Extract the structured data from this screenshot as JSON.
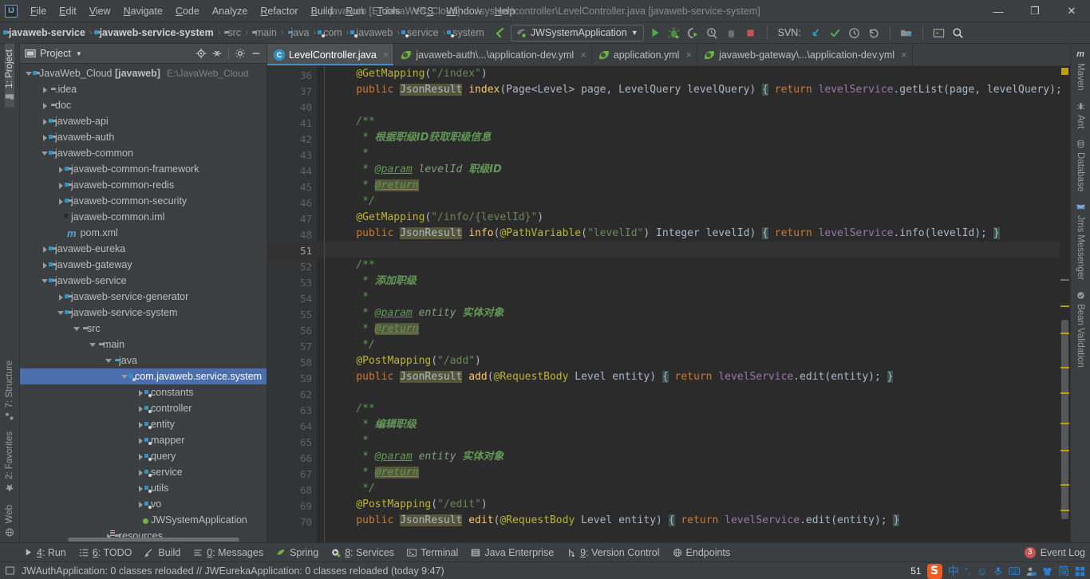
{
  "window": {
    "title": "javaweb [E:\\JavaWeb_Cloud] - ...\\system\\controller\\LevelController.java [javaweb-service-system]",
    "minimize": "—",
    "maximize": "❐",
    "close": "✕"
  },
  "menu": {
    "items": [
      "File",
      "Edit",
      "View",
      "Navigate",
      "Code",
      "Analyze",
      "Refactor",
      "Build",
      "Run",
      "Tools",
      "VCS",
      "Window",
      "Help"
    ]
  },
  "navbar": {
    "breadcrumbs": [
      {
        "label": "javaweb-service",
        "icon": "module-icon",
        "bold": true
      },
      {
        "label": "javaweb-service-system",
        "icon": "module-icon",
        "bold": true
      },
      {
        "label": "src",
        "icon": "folder-icon",
        "bold": false
      },
      {
        "label": "main",
        "icon": "folder-icon",
        "bold": false
      },
      {
        "label": "java",
        "icon": "source-folder-icon",
        "bold": false
      },
      {
        "label": "com",
        "icon": "package-icon",
        "bold": false
      },
      {
        "label": "javaweb",
        "icon": "package-icon",
        "bold": false
      },
      {
        "label": "service",
        "icon": "package-icon",
        "bold": false
      },
      {
        "label": "system",
        "icon": "package-icon",
        "bold": false
      }
    ],
    "run_config": "JWSystemApplication",
    "svn_label": "SVN:",
    "toolbar_icons": [
      "back-arrow-icon",
      "run-icon",
      "debug-icon",
      "run-coverage-icon",
      "profiler-icon",
      "attach-icon",
      "stop-icon",
      "svn-update-icon",
      "svn-commit-icon",
      "svn-history-icon",
      "svn-rollback-icon",
      "project-structure-icon",
      "terminal-icon",
      "search-everywhere-icon"
    ]
  },
  "left_strip": {
    "top": [
      {
        "label": "1: Project",
        "icon": "project-icon",
        "active": true
      }
    ],
    "bottom": [
      {
        "label": "7: Structure",
        "icon": "structure-icon"
      },
      {
        "label": "2: Favorites",
        "icon": "star-icon"
      },
      {
        "label": "Web",
        "icon": "web-icon"
      }
    ]
  },
  "right_strip": {
    "items": [
      {
        "label": "Maven",
        "icon": "maven-icon"
      },
      {
        "label": "Ant",
        "icon": "ant-icon"
      },
      {
        "label": "Database",
        "icon": "database-icon"
      },
      {
        "label": "Jms Messenger",
        "icon": "jms-icon"
      },
      {
        "label": "Bean Validation",
        "icon": "bean-validation-icon"
      }
    ]
  },
  "project_panel": {
    "title": "Project",
    "header_icons": [
      "locate-icon",
      "collapse-all-icon",
      "settings-icon",
      "hide-icon"
    ],
    "tree": [
      {
        "depth": 0,
        "arrow": "down",
        "icon": "module-icon",
        "label": "JavaWeb_Cloud",
        "suffix": "[javaweb]",
        "path": "E:\\JavaWeb_Cloud",
        "selected": false
      },
      {
        "depth": 1,
        "arrow": "right",
        "icon": "folder-icon",
        "label": ".idea",
        "selected": false
      },
      {
        "depth": 1,
        "arrow": "right",
        "icon": "folder-icon",
        "label": "doc",
        "selected": false
      },
      {
        "depth": 1,
        "arrow": "right",
        "icon": "module-icon",
        "label": "javaweb-api",
        "selected": false
      },
      {
        "depth": 1,
        "arrow": "right",
        "icon": "module-icon",
        "label": "javaweb-auth",
        "selected": false
      },
      {
        "depth": 1,
        "arrow": "down",
        "icon": "module-icon",
        "label": "javaweb-common",
        "selected": false
      },
      {
        "depth": 2,
        "arrow": "right",
        "icon": "module-icon",
        "label": "javaweb-common-framework",
        "selected": false
      },
      {
        "depth": 2,
        "arrow": "right",
        "icon": "module-icon",
        "label": "javaweb-common-redis",
        "selected": false
      },
      {
        "depth": 2,
        "arrow": "right",
        "icon": "module-icon",
        "label": "javaweb-common-security",
        "selected": false
      },
      {
        "depth": 2,
        "arrow": "none",
        "icon": "iml-file-icon",
        "label": "javaweb-common.iml",
        "selected": false
      },
      {
        "depth": 2,
        "arrow": "none",
        "icon": "maven-pom-icon",
        "label": "pom.xml",
        "selected": false
      },
      {
        "depth": 1,
        "arrow": "right",
        "icon": "module-icon",
        "label": "javaweb-eureka",
        "selected": false
      },
      {
        "depth": 1,
        "arrow": "right",
        "icon": "module-icon",
        "label": "javaweb-gateway",
        "selected": false
      },
      {
        "depth": 1,
        "arrow": "down",
        "icon": "module-icon",
        "label": "javaweb-service",
        "selected": false
      },
      {
        "depth": 2,
        "arrow": "right",
        "icon": "module-icon",
        "label": "javaweb-service-generator",
        "selected": false
      },
      {
        "depth": 2,
        "arrow": "down",
        "icon": "module-icon",
        "label": "javaweb-service-system",
        "selected": false
      },
      {
        "depth": 3,
        "arrow": "down",
        "icon": "folder-icon",
        "label": "src",
        "selected": false
      },
      {
        "depth": 4,
        "arrow": "down",
        "icon": "folder-icon",
        "label": "main",
        "selected": false
      },
      {
        "depth": 5,
        "arrow": "down",
        "icon": "source-folder-icon",
        "label": "java",
        "selected": false
      },
      {
        "depth": 6,
        "arrow": "down",
        "icon": "package-icon",
        "label": "com.javaweb.service.system",
        "selected": true
      },
      {
        "depth": 7,
        "arrow": "right",
        "icon": "package-icon",
        "label": "constants",
        "selected": false
      },
      {
        "depth": 7,
        "arrow": "right",
        "icon": "package-icon",
        "label": "controller",
        "selected": false
      },
      {
        "depth": 7,
        "arrow": "right",
        "icon": "package-icon",
        "label": "entity",
        "selected": false
      },
      {
        "depth": 7,
        "arrow": "right",
        "icon": "package-icon",
        "label": "mapper",
        "selected": false
      },
      {
        "depth": 7,
        "arrow": "right",
        "icon": "package-icon",
        "label": "query",
        "selected": false
      },
      {
        "depth": 7,
        "arrow": "right",
        "icon": "package-icon",
        "label": "service",
        "selected": false
      },
      {
        "depth": 7,
        "arrow": "right",
        "icon": "package-icon",
        "label": "utils",
        "selected": false
      },
      {
        "depth": 7,
        "arrow": "right",
        "icon": "package-icon",
        "label": "vo",
        "selected": false
      },
      {
        "depth": 7,
        "arrow": "none",
        "icon": "spring-boot-class-icon",
        "label": "JWSystemApplication",
        "selected": false
      },
      {
        "depth": 5,
        "arrow": "right",
        "icon": "resources-folder-icon",
        "label": "resources",
        "selected": false
      }
    ]
  },
  "editor": {
    "tabs": [
      {
        "label": "LevelController.java",
        "icon": "java-class-icon",
        "active": true
      },
      {
        "label": "javaweb-auth\\...\\application-dev.yml",
        "icon": "spring-yaml-icon",
        "active": false
      },
      {
        "label": "application.yml",
        "icon": "spring-yaml-icon",
        "active": false
      },
      {
        "label": "javaweb-gateway\\...\\application-dev.yml",
        "icon": "spring-yaml-icon",
        "active": false
      }
    ],
    "current_line": 51,
    "lines": [
      {
        "n": 36,
        "fold": "none",
        "html": "    <span class=\"ann\">@GetMapping</span>(<span class=\"str\">\"/index\"</span>)"
      },
      {
        "n": 37,
        "fold": "plus",
        "html": "    <span class=\"kw\">public</span> <span class=\"typehl\">JsonResult</span> <span class=\"meth\">index</span>(Page&lt;Level&gt; page, LevelQuery levelQuery) <span class=\"brace-hl\">{</span> <span class=\"kw\">return</span> <span class=\"fld\">levelService</span>.getList(page, levelQuery); <span class=\"brace-hl\">}</span>"
      },
      {
        "n": 40,
        "fold": "none",
        "html": ""
      },
      {
        "n": 41,
        "fold": "minus-top",
        "html": "    <span class=\"cmt\">/**</span>"
      },
      {
        "n": 42,
        "fold": "none",
        "html": "     <span class=\"cmt\">* </span><span class=\"cmt cjk\">根据职级ID获取职级信息</span>"
      },
      {
        "n": 43,
        "fold": "none",
        "html": "     <span class=\"cmt\">*</span>"
      },
      {
        "n": 44,
        "fold": "none",
        "html": "     <span class=\"cmt\">* </span><span class=\"cmt-tag\">@param</span><span class=\"cmt-param\"> levelId </span><span class=\"cmt cjk\">职级ID</span>"
      },
      {
        "n": 45,
        "fold": "none",
        "html": "     <span class=\"cmt\">* </span><span class=\"cmt-tag cmt-hl\">@return</span>"
      },
      {
        "n": 46,
        "fold": "minus-bot",
        "html": "     <span class=\"cmt\">*/</span>"
      },
      {
        "n": 47,
        "fold": "none",
        "html": "    <span class=\"ann\">@GetMapping</span>(<span class=\"str\">\"/info/{levelId}\"</span>)"
      },
      {
        "n": 48,
        "fold": "plus",
        "html": "    <span class=\"kw\">public</span> <span class=\"typehl\">JsonResult</span> <span class=\"meth\">info</span>(<span class=\"ann\">@PathVariable</span>(<span class=\"str\">\"levelId\"</span>) Integer levelId) <span class=\"brace-hl\">{</span> <span class=\"kw\">return</span> <span class=\"fld\">levelService</span>.info(levelId); <span class=\"brace-hl\">}</span>"
      },
      {
        "n": 51,
        "fold": "none",
        "html": "",
        "current": true
      },
      {
        "n": 52,
        "fold": "minus-top",
        "html": "    <span class=\"cmt\">/**</span>"
      },
      {
        "n": 53,
        "fold": "none",
        "html": "     <span class=\"cmt\">* </span><span class=\"cmt cjk\">添加职级</span>"
      },
      {
        "n": 54,
        "fold": "none",
        "html": "     <span class=\"cmt\">*</span>"
      },
      {
        "n": 55,
        "fold": "none",
        "html": "     <span class=\"cmt\">* </span><span class=\"cmt-tag\">@param</span><span class=\"cmt-param\"> entity </span><span class=\"cmt cjk\">实体对象</span>"
      },
      {
        "n": 56,
        "fold": "none",
        "html": "     <span class=\"cmt\">* </span><span class=\"cmt-tag cmt-hl\">@return</span>"
      },
      {
        "n": 57,
        "fold": "minus-bot",
        "html": "     <span class=\"cmt\">*/</span>"
      },
      {
        "n": 58,
        "fold": "none",
        "html": "    <span class=\"ann\">@PostMapping</span>(<span class=\"str\">\"/add\"</span>)"
      },
      {
        "n": 59,
        "fold": "plus",
        "html": "    <span class=\"kw\">public</span> <span class=\"typehl\">JsonResult</span> <span class=\"meth\">add</span>(<span class=\"ann\">@RequestBody</span> Level entity) <span class=\"brace-hl\">{</span> <span class=\"kw\">return</span> <span class=\"fld\">levelService</span>.edit(entity); <span class=\"brace-hl\">}</span>"
      },
      {
        "n": 62,
        "fold": "none",
        "html": ""
      },
      {
        "n": 63,
        "fold": "minus-top",
        "html": "    <span class=\"cmt\">/**</span>"
      },
      {
        "n": 64,
        "fold": "none",
        "html": "     <span class=\"cmt\">* </span><span class=\"cmt cjk\">编辑职级</span>"
      },
      {
        "n": 65,
        "fold": "none",
        "html": "     <span class=\"cmt\">*</span>"
      },
      {
        "n": 66,
        "fold": "none",
        "html": "     <span class=\"cmt\">* </span><span class=\"cmt-tag\">@param</span><span class=\"cmt-param\"> entity </span><span class=\"cmt cjk\">实体对象</span>"
      },
      {
        "n": 67,
        "fold": "none",
        "html": "     <span class=\"cmt\">* </span><span class=\"cmt-tag cmt-hl\">@return</span>"
      },
      {
        "n": 68,
        "fold": "minus-bot",
        "html": "     <span class=\"cmt\">*/</span>"
      },
      {
        "n": 69,
        "fold": "none",
        "html": "    <span class=\"ann\">@PostMapping</span>(<span class=\"str\">\"/edit\"</span>)"
      },
      {
        "n": 70,
        "fold": "plus",
        "html": "    <span class=\"kw\">public</span> <span class=\"typehl\">JsonResult</span> <span class=\"meth\">edit</span>(<span class=\"ann\">@RequestBody</span> Level entity) <span class=\"brace-hl\">{</span> <span class=\"kw\">return</span> <span class=\"fld\">levelService</span>.edit(entity); <span class=\"brace-hl\">}</span>"
      }
    ]
  },
  "toolwindow_bar": {
    "items": [
      {
        "label": "4: Run",
        "icon": "run-icon"
      },
      {
        "label": "6: TODO",
        "icon": "todo-icon"
      },
      {
        "label": "Build",
        "icon": "build-hammer-icon"
      },
      {
        "label": "0: Messages",
        "icon": "messages-icon"
      },
      {
        "label": "Spring",
        "icon": "spring-leaf-icon"
      },
      {
        "label": "8: Services",
        "icon": "services-icon"
      },
      {
        "label": "Terminal",
        "icon": "terminal-icon"
      },
      {
        "label": "Java Enterprise",
        "icon": "java-enterprise-icon"
      },
      {
        "label": "9: Version Control",
        "icon": "version-control-icon"
      },
      {
        "label": "Endpoints",
        "icon": "endpoints-icon"
      }
    ],
    "event_log": {
      "label": "Event Log",
      "count": "3"
    }
  },
  "statusbar": {
    "message": "JWAuthApplication: 0 classes reloaded // JWEurekaApplication: 0 classes reloaded (today 9:47)",
    "tray": {
      "number": "51",
      "ime_logo": "S",
      "items": [
        "中",
        "°,",
        "☺",
        "🎤",
        "⌨",
        "👤",
        "👕",
        "简",
        "▦"
      ]
    }
  },
  "colors": {
    "accent_blue": "#4b6eaf",
    "editor_bg": "#2b2b2b",
    "panel_bg": "#3c3f41",
    "gutter_bg": "#313335",
    "keyword": "#cc7832",
    "annotation": "#bbb529",
    "string": "#6a8759",
    "comment": "#629755",
    "method": "#ffc66d",
    "field": "#9876aa",
    "badge_red": "#c75450",
    "warn_yellow": "#bba000"
  }
}
